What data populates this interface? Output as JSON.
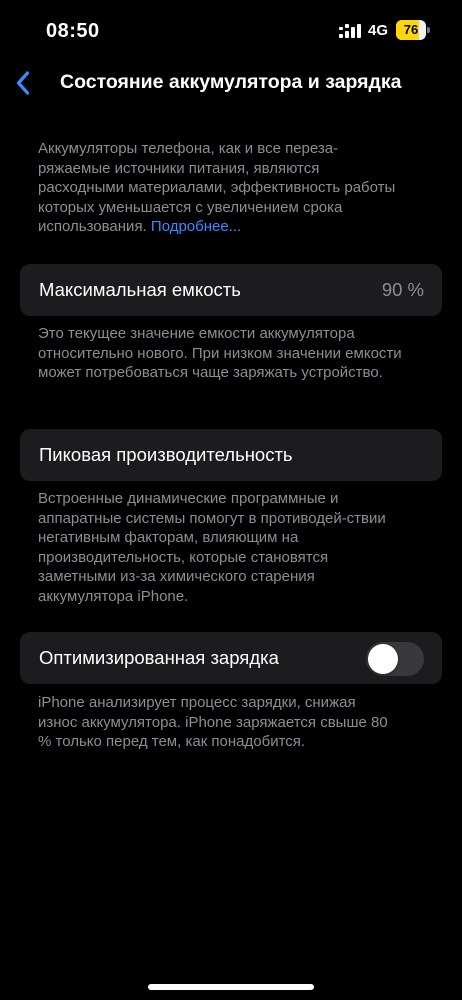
{
  "status_bar": {
    "time": "08:50",
    "network": "4G",
    "battery_level": "76",
    "battery_fraction": 0.76,
    "battery_color": "#ffd60a"
  },
  "nav": {
    "back_icon": "chevron-left-icon",
    "title": "Состояние аккумулятора и зарядка"
  },
  "intro": {
    "text": "Аккумуляторы телефона, как и все переза-ряжаемые источники питания, являются расходными материалами, эффективность работы которых уменьшается с увеличением срока использования. ",
    "link": "Подробнее..."
  },
  "max_capacity": {
    "label": "Максимальная емкость",
    "value": "90 %",
    "footer": "Это текущее значение емкости аккумулятора относительно нового. При низком значении емкости может потребоваться чаще заряжать устройство."
  },
  "peak_performance": {
    "label": "Пиковая производительность",
    "footer": "Встроенные динамические программные и аппаратные системы помогут в противодей-ствии негативным факторам, влияющим на производительность, которые становятся заметными из-за химического старения аккумулятора iPhone."
  },
  "optimized_charging": {
    "label": "Оптимизированная зарядка",
    "enabled": false,
    "footer": "iPhone анализирует процесс зарядки, снижая износ аккумулятора. iPhone заряжается свыше 80 % только перед тем, как понадобится."
  },
  "colors": {
    "accent": "#3b8bff",
    "cell_background": "#1c1c1e",
    "secondary_text": "#8d8d93"
  }
}
